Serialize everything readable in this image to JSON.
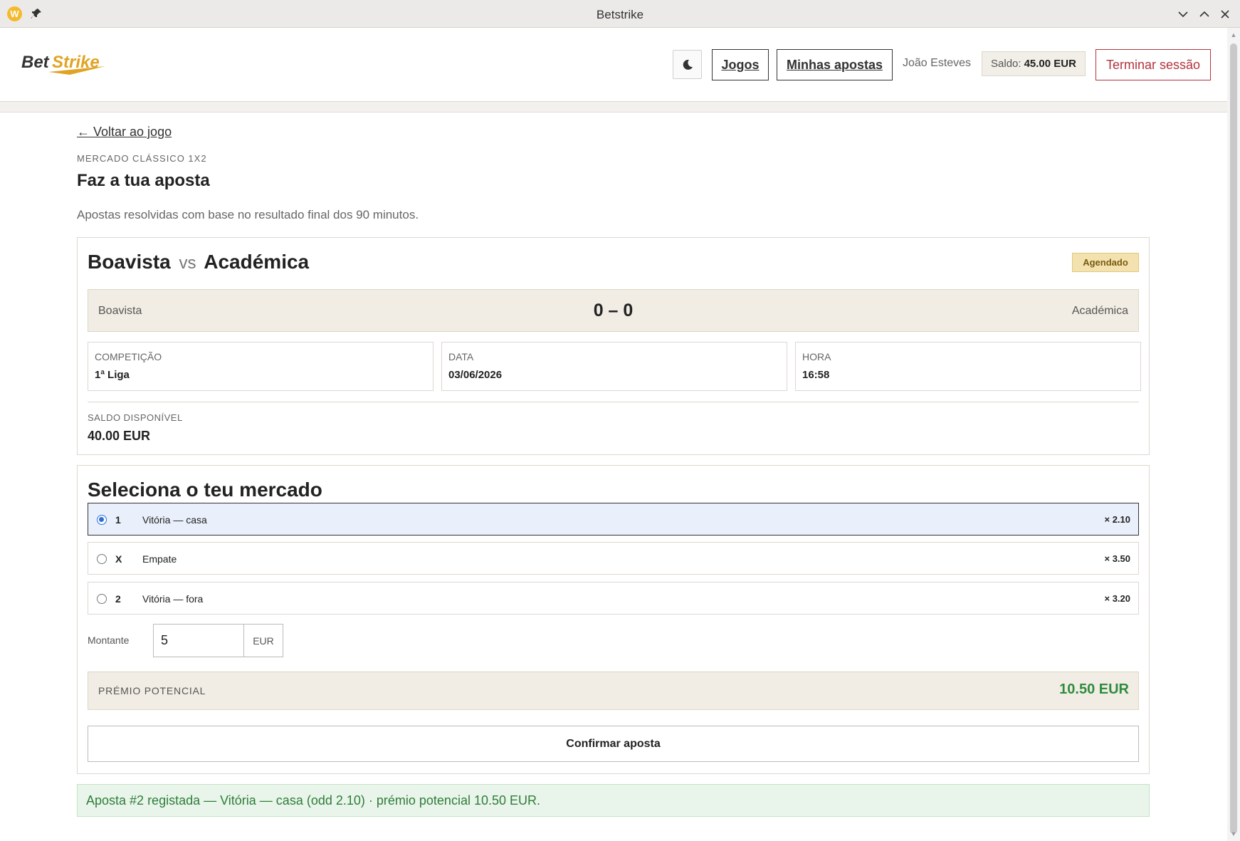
{
  "window": {
    "title": "Betstrike"
  },
  "header": {
    "logo_text": "BetStrike",
    "nav": {
      "games_label": "Jogos",
      "my_bets_label": "Minhas apostas"
    },
    "user_name": "João Esteves",
    "balance_label": "Saldo:",
    "balance_value": "45.00 EUR",
    "logout_label": "Terminar sessão"
  },
  "page": {
    "back_link": "← Voltar ao jogo",
    "eyebrow": "MERCADO CLÁSSICO 1X2",
    "title": "Faz a tua aposta",
    "description": "Apostas resolvidas com base no resultado final dos 90 minutos."
  },
  "match": {
    "home": "Boavista",
    "vs": "vs",
    "away": "Académica",
    "status": "Agendado",
    "score": "0 – 0",
    "info": [
      {
        "label": "COMPETIÇÃO",
        "value": "1ª Liga"
      },
      {
        "label": "DATA",
        "value": "03/06/2026"
      },
      {
        "label": "HORA",
        "value": "16:58"
      }
    ],
    "available_balance_label": "SALDO DISPONÍVEL",
    "available_balance_value": "40.00 EUR"
  },
  "market": {
    "title": "Seleciona o teu mercado",
    "options": [
      {
        "code": "1",
        "label": "Vitória — casa",
        "odd": "× 2.10",
        "selected": true
      },
      {
        "code": "X",
        "label": "Empate",
        "odd": "× 3.50",
        "selected": false
      },
      {
        "code": "2",
        "label": "Vitória — fora",
        "odd": "× 3.20",
        "selected": false
      }
    ],
    "amount_label": "Montante",
    "amount_value": "5",
    "amount_unit": "EUR",
    "prize_label": "PRÉMIO POTENCIAL",
    "prize_value": "10.50 EUR",
    "confirm_label": "Confirmar aposta"
  },
  "success_message": "Aposta #2 registada — Vitória — casa (odd 2.10) · prémio potencial 10.50 EUR.",
  "colors": {
    "accent_gold": "#e0a424",
    "danger": "#b3343d",
    "success": "#2f8c3e",
    "selected_bg": "#eaf0fb"
  }
}
